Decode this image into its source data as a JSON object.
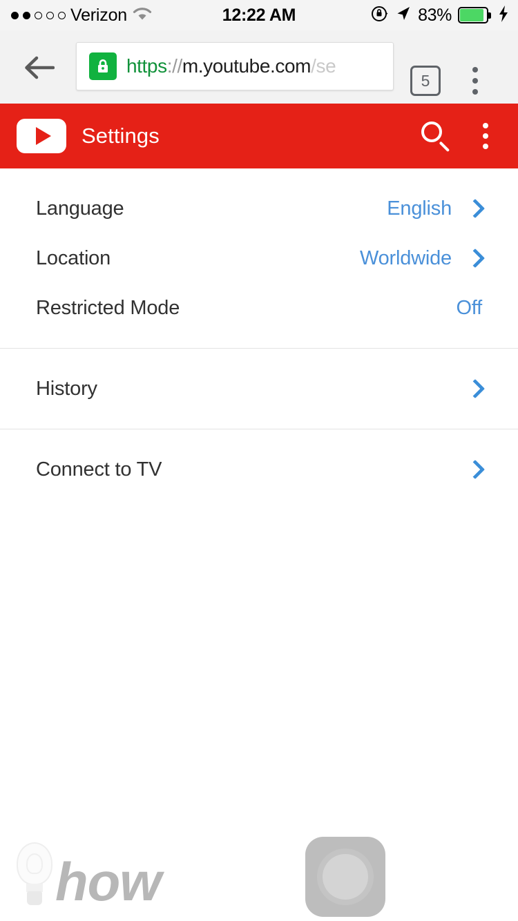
{
  "status_bar": {
    "signal_dots_total": 5,
    "signal_dots_filled": 2,
    "carrier": "Verizon",
    "wifi_icon": "wifi-icon",
    "time": "12:22 AM",
    "rotation_lock_icon": "rotation-lock-icon",
    "location_icon": "location-arrow-icon",
    "battery_percent": "83%",
    "battery_icon": "battery-icon",
    "charging_icon": "lightning-bolt-icon"
  },
  "browser": {
    "back_icon": "back-arrow-icon",
    "lock_icon": "lock-icon",
    "url": {
      "scheme": "https",
      "separator": "://",
      "host": "m.youtube.com",
      "path": "/se"
    },
    "tab_count": "5",
    "menu_icon": "overflow-menu-icon"
  },
  "app_bar": {
    "logo_icon": "youtube-play-logo",
    "title": "Settings",
    "search_icon": "search-icon",
    "menu_icon": "overflow-menu-icon",
    "background_color": "#e52117"
  },
  "settings": {
    "accent_color": "#3b8ed8",
    "groups": [
      {
        "rows": [
          {
            "label": "Language",
            "value": "English",
            "chevron": true
          },
          {
            "label": "Location",
            "value": "Worldwide",
            "chevron": true
          },
          {
            "label": "Restricted Mode",
            "value": "Off",
            "chevron": false
          }
        ]
      },
      {
        "rows": [
          {
            "label": "History",
            "value": "",
            "chevron": true
          }
        ]
      },
      {
        "rows": [
          {
            "label": "Connect to TV",
            "value": "",
            "chevron": true
          }
        ]
      }
    ]
  },
  "watermark": {
    "bulb_icon": "lightbulb-icon",
    "text": "how"
  },
  "assistive_touch": {
    "icon": "assistive-touch-button"
  }
}
